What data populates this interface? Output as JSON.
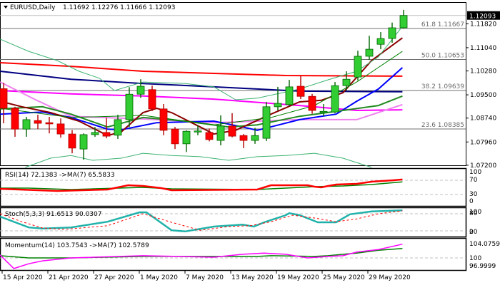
{
  "header": {
    "symbol_timeframe": "EURUSD,Daily",
    "ohlc": "1.11692 1.12276 1.11666 1.12093",
    "menu_icon": "triangle-down-icon"
  },
  "current_price": "1.12093",
  "colors": {
    "bull": "#32cd32",
    "bear": "#ff0000",
    "bull_border": "#006400",
    "bear_border": "#b00000"
  },
  "chart_data": {
    "type": "candlestick",
    "title": "EURUSD,Daily",
    "price_axis": {
      "ticks": [
        "1.11820",
        "1.11040",
        "1.10280",
        "1.09500",
        "1.08740",
        "1.07960",
        "1.07200"
      ],
      "range": [
        1.0715,
        1.1255
      ]
    },
    "x_labels": [
      {
        "label": "15 Apr 2020",
        "index": 0
      },
      {
        "label": "21 Apr 2020",
        "index": 4
      },
      {
        "label": "27 Apr 2020",
        "index": 8
      },
      {
        "label": "1 May 2020",
        "index": 12
      },
      {
        "label": "7 May 2020",
        "index": 16
      },
      {
        "label": "13 May 2020",
        "index": 20
      },
      {
        "label": "19 May 2020",
        "index": 24
      },
      {
        "label": "25 May 2020",
        "index": 28
      },
      {
        "label": "29 May 2020",
        "index": 32
      }
    ],
    "fib_levels": [
      {
        "label": "61.8 1.11667",
        "value": 1.11667
      },
      {
        "label": "50.0 1.10653",
        "value": 1.10653
      },
      {
        "label": "38.2 1.09639",
        "value": 1.09639
      },
      {
        "label": "23.6 1.08385",
        "value": 1.08385
      }
    ],
    "candles": [
      [
        1.097,
        1.0989,
        1.0857,
        1.0906
      ],
      [
        1.0906,
        1.0911,
        1.0813,
        1.0838
      ],
      [
        1.0838,
        1.0878,
        1.0813,
        1.0869
      ],
      [
        1.0866,
        1.0885,
        1.0838,
        1.0857
      ],
      [
        1.0859,
        1.0878,
        1.0824,
        1.0855
      ],
      [
        1.0855,
        1.0873,
        1.081,
        1.0822
      ],
      [
        1.0822,
        1.0835,
        1.0759,
        1.0776
      ],
      [
        1.0773,
        1.0824,
        1.0738,
        1.082
      ],
      [
        1.082,
        1.0845,
        1.0813,
        1.0827
      ],
      [
        1.0827,
        1.0875,
        1.0808,
        1.0815
      ],
      [
        1.0818,
        1.0885,
        1.0806,
        1.0869
      ],
      [
        1.0869,
        1.0975,
        1.0845,
        1.0952
      ],
      [
        1.0952,
        1.1001,
        1.094,
        1.0978
      ],
      [
        1.0967,
        1.098,
        1.0897,
        1.0904
      ],
      [
        1.0904,
        1.092,
        1.0818,
        1.0834
      ],
      [
        1.0838,
        1.0845,
        1.0773,
        1.079
      ],
      [
        1.079,
        1.0834,
        1.0763,
        1.0831
      ],
      [
        1.0829,
        1.085,
        1.0818,
        1.0832
      ],
      [
        1.0827,
        1.084,
        1.0798,
        1.0804
      ],
      [
        1.0801,
        1.0883,
        1.0785,
        1.0848
      ],
      [
        1.0848,
        1.089,
        1.0811,
        1.0815
      ],
      [
        1.0817,
        1.0822,
        1.0776,
        1.0801
      ],
      [
        1.0801,
        1.0842,
        1.079,
        1.0817
      ],
      [
        1.0808,
        1.0927,
        1.0799,
        1.0911
      ],
      [
        1.0911,
        1.0976,
        1.0899,
        1.0922
      ],
      [
        1.0918,
        1.0999,
        1.0913,
        1.0976
      ],
      [
        1.0978,
        1.1011,
        1.0936,
        1.0945
      ],
      [
        1.0945,
        1.0953,
        1.0888,
        1.0899
      ],
      [
        1.0892,
        1.092,
        1.088,
        1.0896
      ],
      [
        1.0894,
        1.0992,
        1.089,
        1.098
      ],
      [
        1.098,
        1.1027,
        1.0964,
        1.1001
      ],
      [
        1.1008,
        1.1094,
        1.0997,
        1.1076
      ],
      [
        1.1076,
        1.1143,
        1.1064,
        1.1099
      ],
      [
        1.1115,
        1.1155,
        1.1099,
        1.1134
      ],
      [
        1.1134,
        1.1186,
        1.112,
        1.1169
      ],
      [
        1.11692,
        1.12276,
        1.11666,
        1.12093
      ]
    ],
    "overlays": [
      {
        "name": "ma-red",
        "color": "#ff0000",
        "width": 2,
        "points": [
          [
            -0.3,
            1.1055
          ],
          [
            5.9,
            1.1043
          ],
          [
            12.2,
            1.1027
          ],
          [
            18.4,
            1.102
          ],
          [
            24.7,
            1.1013
          ],
          [
            34.9,
            1.1011
          ]
        ]
      },
      {
        "name": "ma-navy",
        "color": "#000080",
        "width": 2,
        "points": [
          [
            -0.3,
            1.1027
          ],
          [
            5.9,
            1.1001
          ],
          [
            12.2,
            1.0987
          ],
          [
            18.4,
            1.0976
          ],
          [
            25.9,
            1.0962
          ],
          [
            34.9,
            1.096
          ]
        ]
      },
      {
        "name": "ma-magenta",
        "color": "#ff00ff",
        "width": 2,
        "points": [
          [
            -0.3,
            1.0964
          ],
          [
            5.9,
            1.0953
          ],
          [
            12.2,
            1.0946
          ],
          [
            18.4,
            1.0936
          ],
          [
            25.9,
            1.0915
          ],
          [
            30.9,
            1.0899
          ],
          [
            34.9,
            1.0901
          ]
        ]
      },
      {
        "name": "ma-violet",
        "color": "#ee82ee",
        "width": 2,
        "points": [
          [
            -0.3,
            1.0992
          ],
          [
            2.8,
            1.0934
          ],
          [
            5.9,
            1.088
          ],
          [
            12.2,
            1.0871
          ],
          [
            18.4,
            1.0859
          ],
          [
            25.9,
            1.0869
          ],
          [
            30.9,
            1.0869
          ],
          [
            34.9,
            1.0918
          ]
        ]
      },
      {
        "name": "ma-blue",
        "color": "#0000ff",
        "width": 2,
        "points": [
          [
            -0.3,
            1.0887
          ],
          [
            3.4,
            1.0894
          ],
          [
            5.9,
            1.0876
          ],
          [
            9.1,
            1.0838
          ],
          [
            10.3,
            1.0836
          ],
          [
            13.4,
            1.0859
          ],
          [
            18.4,
            1.0864
          ],
          [
            20.9,
            1.0845
          ],
          [
            22.2,
            1.0834
          ],
          [
            25.9,
            1.0869
          ],
          [
            29.1,
            1.0887
          ],
          [
            30.9,
            1.0929
          ],
          [
            32.8,
            1.0969
          ],
          [
            34.9,
            1.1039
          ]
        ]
      },
      {
        "name": "ma-darkgreen",
        "color": "#228b22",
        "width": 2,
        "points": [
          [
            -0.3,
            1.0904
          ],
          [
            3.4,
            1.0911
          ],
          [
            5.9,
            1.0887
          ],
          [
            9.1,
            1.0845
          ],
          [
            12.2,
            1.0876
          ],
          [
            15.9,
            1.0864
          ],
          [
            19.7,
            1.0845
          ],
          [
            22.2,
            1.0852
          ],
          [
            25.9,
            1.088
          ],
          [
            29.7,
            1.0899
          ],
          [
            32.8,
            1.0915
          ],
          [
            34.9,
            1.0946
          ]
        ]
      },
      {
        "name": "ma-darkred",
        "color": "#8b0000",
        "width": 2,
        "points": [
          [
            -0.3,
            1.0929
          ],
          [
            1.6,
            1.0911
          ],
          [
            4.1,
            1.0892
          ],
          [
            6.6,
            1.0864
          ],
          [
            9.1,
            1.0817
          ],
          [
            10.3,
            1.0829
          ],
          [
            12.2,
            1.0892
          ],
          [
            13.4,
            1.0906
          ],
          [
            14.7,
            1.0892
          ],
          [
            17.2,
            1.0845
          ],
          [
            18.4,
            1.0822
          ],
          [
            20.3,
            1.0834
          ],
          [
            23.4,
            1.0887
          ],
          [
            25.9,
            1.0927
          ],
          [
            27.8,
            1.0932
          ],
          [
            29.7,
            1.0957
          ],
          [
            32.2,
            1.1062
          ],
          [
            34.9,
            1.1136
          ]
        ]
      },
      {
        "name": "band-upper",
        "color": "#3cb371",
        "width": 1,
        "points": [
          [
            -0.3,
            1.1132
          ],
          [
            2.2,
            1.1092
          ],
          [
            4.7,
            1.1062
          ],
          [
            6.6,
            1.1027
          ],
          [
            8.4,
            1.1004
          ],
          [
            9.7,
            1.0964
          ],
          [
            12.2,
            1.0992
          ],
          [
            15.9,
            1.0987
          ],
          [
            18.4,
            1.0976
          ],
          [
            20.3,
            1.0934
          ],
          [
            22.2,
            1.0939
          ],
          [
            25.9,
            1.0969
          ],
          [
            28.4,
            1.0999
          ],
          [
            30.9,
            1.1027
          ],
          [
            32.8,
            1.1074
          ],
          [
            34.9,
            1.1174
          ]
        ]
      },
      {
        "name": "band-middle",
        "color": "#008000",
        "width": 1,
        "points": [
          [
            -0.3,
            1.0906
          ],
          [
            5.9,
            1.0876
          ],
          [
            12.2,
            1.0883
          ],
          [
            18.4,
            1.0852
          ],
          [
            23.4,
            1.0876
          ],
          [
            27.2,
            1.0915
          ],
          [
            30.9,
            1.0992
          ],
          [
            34.9,
            1.1092
          ]
        ]
      },
      {
        "name": "band-lower",
        "color": "#3cb371",
        "width": 1,
        "points": [
          [
            1.9,
            1.0713
          ],
          [
            4.1,
            1.0743
          ],
          [
            5.9,
            1.0752
          ],
          [
            7.8,
            1.0736
          ],
          [
            10.3,
            1.0743
          ],
          [
            12.2,
            1.0759
          ],
          [
            14.7,
            1.0752
          ],
          [
            17.2,
            1.0748
          ],
          [
            19.7,
            1.0736
          ],
          [
            22.2,
            1.0748
          ],
          [
            24.7,
            1.0752
          ],
          [
            27.2,
            1.0759
          ],
          [
            29.7,
            1.0743
          ],
          [
            32.2,
            1.0713
          ]
        ]
      }
    ],
    "rsi": {
      "label": "RSI(14) 72.1383  ->MA(7) 65.5833",
      "scale_labels": [
        "100",
        "70",
        "30",
        "0"
      ],
      "levels": [
        70,
        30
      ],
      "rsi": [
        [
          -0.3,
          46
        ],
        [
          4.7,
          40
        ],
        [
          9.1,
          44
        ],
        [
          10,
          50
        ],
        [
          10.9,
          56
        ],
        [
          12.2,
          54
        ],
        [
          13.8,
          48
        ],
        [
          14.7,
          42
        ],
        [
          22.2,
          44
        ],
        [
          22.8,
          50
        ],
        [
          23.4,
          56
        ],
        [
          26.6,
          56
        ],
        [
          27.2,
          52
        ],
        [
          27.8,
          50
        ],
        [
          28.4,
          54
        ],
        [
          29.1,
          58
        ],
        [
          30.9,
          60
        ],
        [
          32.2,
          66
        ],
        [
          34.1,
          70
        ],
        [
          34.9,
          72.1
        ]
      ],
      "ma": [
        [
          -0.3,
          48
        ],
        [
          2.2,
          48
        ],
        [
          5.9,
          44
        ],
        [
          12.2,
          50
        ],
        [
          14.7,
          46
        ],
        [
          22.2,
          44
        ],
        [
          23.4,
          46
        ],
        [
          24.7,
          48
        ],
        [
          27.2,
          52
        ],
        [
          29.7,
          54
        ],
        [
          32.2,
          58
        ],
        [
          34.9,
          65.6
        ]
      ]
    },
    "stoch": {
      "label": "Stoch(5,3,3) 91.6513 90.0307",
      "scale_labels": [
        "100",
        "80",
        "20",
        "0"
      ],
      "levels": [
        80,
        20
      ],
      "k": [
        [
          -0.3,
          70
        ],
        [
          2.2,
          32
        ],
        [
          3.4,
          28
        ],
        [
          5.9,
          32
        ],
        [
          9.1,
          52
        ],
        [
          11.9,
          85
        ],
        [
          12.5,
          85
        ],
        [
          14.7,
          22
        ],
        [
          15.9,
          18
        ],
        [
          18.4,
          35
        ],
        [
          20.9,
          42
        ],
        [
          21.9,
          35
        ],
        [
          22.8,
          50
        ],
        [
          24.7,
          75
        ],
        [
          25,
          82
        ],
        [
          25.9,
          75
        ],
        [
          27.5,
          50
        ],
        [
          29.1,
          50
        ],
        [
          30.3,
          78
        ],
        [
          32.2,
          88
        ],
        [
          34.9,
          91.7
        ]
      ],
      "d": [
        [
          -0.3,
          80
        ],
        [
          1.6,
          52
        ],
        [
          3.4,
          30
        ],
        [
          5.3,
          25
        ],
        [
          9.1,
          38
        ],
        [
          12.2,
          80
        ],
        [
          14.7,
          50
        ],
        [
          17.2,
          22
        ],
        [
          19.7,
          35
        ],
        [
          21.6,
          38
        ],
        [
          23.4,
          52
        ],
        [
          25.3,
          75
        ],
        [
          27.2,
          65
        ],
        [
          29.1,
          52
        ],
        [
          30.9,
          62
        ],
        [
          32.8,
          80
        ],
        [
          34.9,
          90
        ]
      ]
    },
    "momentum": {
      "label": "Momentum(14) 103.7543  ->MA(7) 102.5789",
      "scale_labels": [
        "104.0759",
        "100",
        "96.9999"
      ],
      "levels": [
        100
      ],
      "mom": [
        [
          -0.3,
          100.8
        ],
        [
          0.9,
          97.1
        ],
        [
          2.2,
          98.4
        ],
        [
          3.4,
          99.2
        ],
        [
          5.9,
          100
        ],
        [
          12.2,
          100.6
        ],
        [
          18.4,
          100.2
        ],
        [
          20.9,
          101
        ],
        [
          22.8,
          101.3
        ],
        [
          24.7,
          101
        ],
        [
          26.6,
          100
        ],
        [
          28.4,
          100.4
        ],
        [
          29.7,
          100.6
        ],
        [
          30.9,
          101.6
        ],
        [
          32.8,
          102.3
        ],
        [
          34.9,
          103.75
        ]
      ],
      "ma": [
        [
          -0.3,
          100.6
        ],
        [
          2.2,
          100
        ],
        [
          5.9,
          100
        ],
        [
          12.2,
          100.4
        ],
        [
          18.4,
          100.4
        ],
        [
          22.2,
          100.4
        ],
        [
          23.4,
          100.6
        ],
        [
          27.2,
          100.4
        ],
        [
          28.4,
          100.6
        ],
        [
          29.7,
          101
        ],
        [
          30.9,
          101.3
        ],
        [
          32.8,
          102.1
        ],
        [
          34.9,
          102.58
        ]
      ]
    }
  }
}
